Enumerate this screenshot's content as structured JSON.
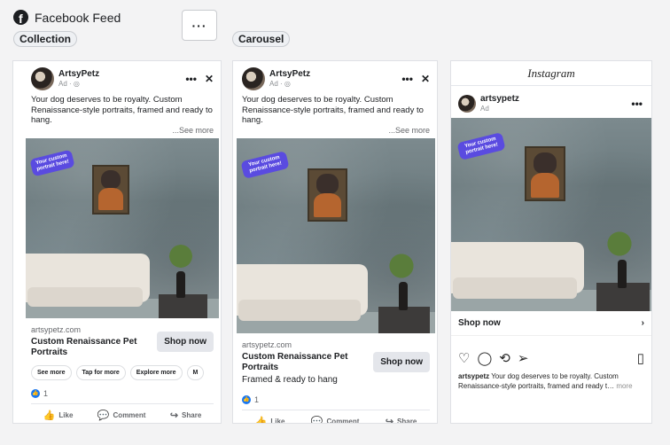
{
  "header": {
    "title": "Facebook Feed",
    "logo_letter": "f",
    "more_label": "···"
  },
  "placements": {
    "collection": "Collection",
    "carousel": "Carousel"
  },
  "ad": {
    "brand": "ArtsyPetz",
    "sponsored": "Ad · ◎",
    "copy": "Your dog deserves to be royalty. Custom Renaissance-style portraits, framed and ready to hang.",
    "see_more": "...See more",
    "bubble": "Your custom portrait here!",
    "domain": "artsypetz.com",
    "headline": "Custom Renaissance Pet Portraits",
    "description": "Framed & ready to hang",
    "cta": "Shop now",
    "more_icon": "•••",
    "close_icon": "✕"
  },
  "collection_chips": [
    "See more",
    "Tap for more",
    "Explore more",
    "M"
  ],
  "reactions": {
    "count": "1",
    "like_icon": "👍"
  },
  "actions": {
    "like": "Like",
    "comment": "Comment",
    "share": "Share"
  },
  "instagram": {
    "logo": "Instagram",
    "handle": "artsypetz",
    "sponsored": "Ad",
    "shop_now": "Shop now",
    "caption_handle": "artsypetz",
    "caption": "Your dog deserves to be royalty. Custom Renaissance-style portraits, framed and ready t…",
    "more": "more"
  }
}
